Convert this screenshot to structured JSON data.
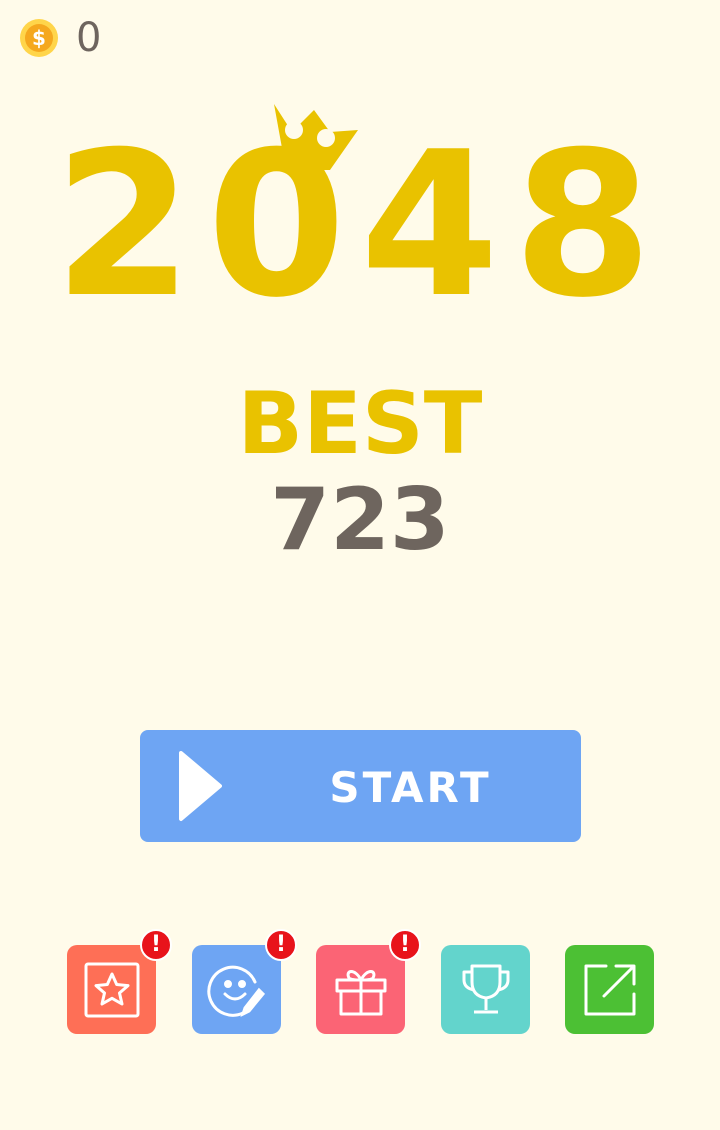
{
  "coins": {
    "count": "0",
    "icon": "dollar-coin-icon",
    "symbol": "$"
  },
  "logo": {
    "text": "2048",
    "color": "#e9c200",
    "icon": "crown-icon"
  },
  "best": {
    "label": "BEST",
    "score": "723"
  },
  "start_button": {
    "label": "START",
    "icon": "play-icon",
    "color": "#6ea5f3"
  },
  "tiles": [
    {
      "icon": "star-icon",
      "color": "#fe6f56",
      "alert": "!"
    },
    {
      "icon": "smiley-pencil-icon",
      "color": "#6ea5f3",
      "alert": "!"
    },
    {
      "icon": "gift-icon",
      "color": "#fb6475",
      "alert": "!"
    },
    {
      "icon": "trophy-icon",
      "color": "#63d4cc"
    },
    {
      "icon": "share-icon",
      "color": "#4cc034"
    }
  ]
}
